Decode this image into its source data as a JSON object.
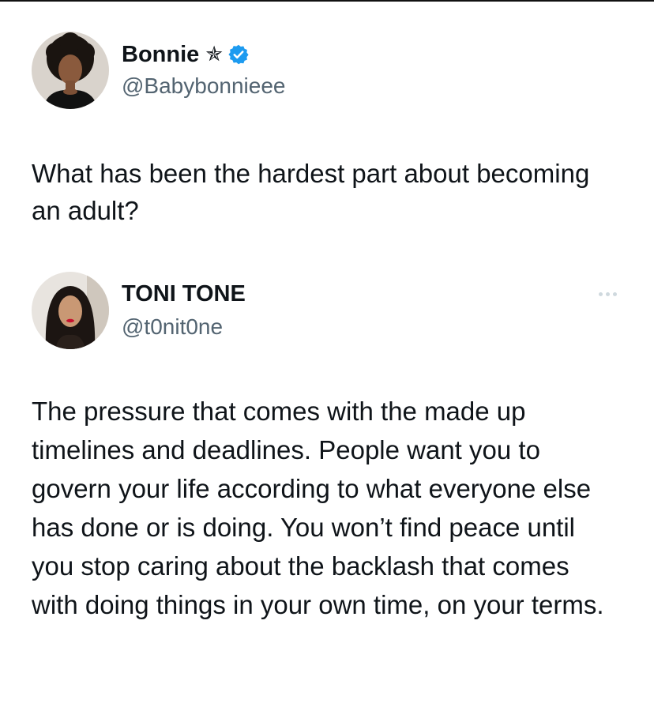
{
  "first_tweet": {
    "display_name": "Bonnie",
    "name_symbol": "✯",
    "handle": "@Babybonnieee",
    "text": "What has been the hardest part about becoming an adult?",
    "avatar_icon": "profile-photo-woman-curly-hair",
    "verified_icon": "verified-badge-icon"
  },
  "reply_tweet": {
    "display_name": "TONI TONE",
    "handle": "@t0nit0ne",
    "text": "The pressure that comes with the made up timelines and deadlines. People want you to govern your life according to what everyone else has done or is doing. You won’t find peace until you stop caring about the backlash that comes with doing things in your own time, on your terms.",
    "avatar_icon": "profile-photo-woman-red-lips",
    "more_icon": "more-options-icon"
  },
  "colors": {
    "text": "#0f1419",
    "secondary": "#536471",
    "verified": "#1d9bf0",
    "more_dots": "#cfd9de"
  }
}
